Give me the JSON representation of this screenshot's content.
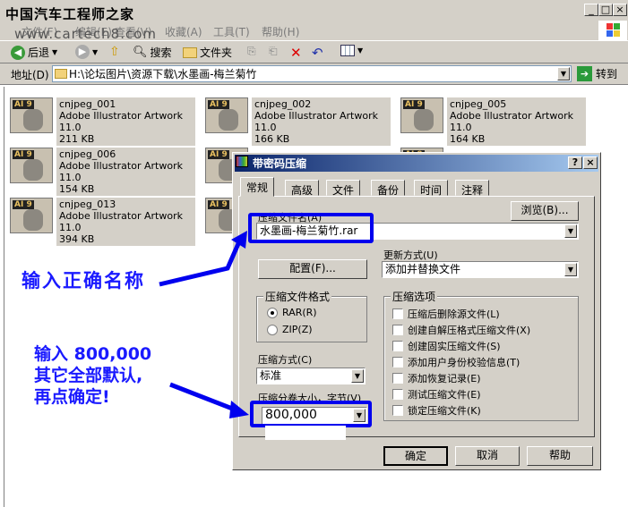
{
  "explorer": {
    "watermark_title": "中国汽车工程师之家",
    "watermark_url": "www.cartech8.com",
    "menu": [
      "文件(F)",
      "编辑(E)",
      "查看(V)",
      "收藏(A)",
      "工具(T)",
      "帮助(H)"
    ],
    "toolbar": {
      "back": "后退",
      "search": "搜索",
      "folders": "文件夹"
    },
    "address_label": "地址(D)",
    "address_value": "H:\\论坛图片\\资源下载\\水墨画-梅兰菊竹",
    "go_label": "转到",
    "files": [
      {
        "name": "cnjpeg_001",
        "type": "Adobe Illustrator Artwork 11.0",
        "size": "211 KB"
      },
      {
        "name": "cnjpeg_002",
        "type": "Adobe Illustrator Artwork 11.0",
        "size": "166 KB"
      },
      {
        "name": "cnjpeg_005",
        "type": "Adobe Illustrator Artwork 11.0",
        "size": "164 KB"
      },
      {
        "name": "cnjpeg_006",
        "type": "Adobe Illustrator Artwork 11.0",
        "size": "154 KB"
      },
      {
        "name": "cnjpeg_013",
        "type": "Adobe Illustrator Artwork 11.0",
        "size": "394 KB"
      }
    ],
    "file_icon_badge": "AI 9"
  },
  "dialog": {
    "title": "带密码压缩",
    "tabs": [
      "常规",
      "高级",
      "文件",
      "备份",
      "时间",
      "注释"
    ],
    "active_tab": "常规",
    "archive_name_label": "压缩文件名(A)",
    "archive_name_value": "水墨画-梅兰菊竹.rar",
    "browse_button": "浏览(B)...",
    "config_button": "配置(F)...",
    "update_mode_label": "更新方式(U)",
    "update_mode_value": "添加并替换文件",
    "format_group_label": "压缩文件格式",
    "format_options": [
      "RAR(R)",
      "ZIP(Z)"
    ],
    "format_selected": "RAR(R)",
    "method_label": "压缩方式(C)",
    "method_value": "标准",
    "volume_label": "压缩分卷大小，字节(V)",
    "volume_value": "800,000",
    "options_group_label": "压缩选项",
    "options": [
      "压缩后删除源文件(L)",
      "创建自解压格式压缩文件(X)",
      "创建固实压缩文件(S)",
      "添加用户身份校验信息(T)",
      "添加恢复记录(E)",
      "测试压缩文件(E)",
      "锁定压缩文件(K)"
    ],
    "ok_button": "确定",
    "cancel_button": "取消",
    "help_button": "帮助"
  },
  "annotations": {
    "note1": "输入正确名称",
    "note2_line1": "输入 800,000",
    "note2_line2": "其它全部默认,",
    "note2_line3": "再点确定!"
  },
  "colors": {
    "annotation": "#1a1aff",
    "title_gradient_start": "#0a246a"
  }
}
